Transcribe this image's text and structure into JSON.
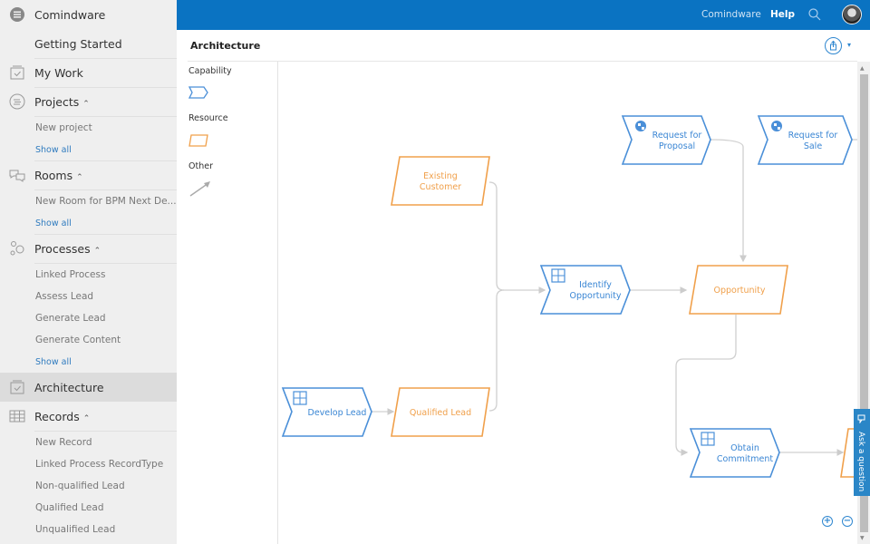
{
  "sidebar": {
    "brand": "Comindware",
    "getting_started": "Getting Started",
    "my_work": "My Work",
    "projects": {
      "label": "Projects",
      "items": [
        "New project"
      ],
      "show_all": "Show all"
    },
    "rooms": {
      "label": "Rooms",
      "items": [
        "New Room for BPM Next De..."
      ],
      "show_all": "Show all"
    },
    "processes": {
      "label": "Processes",
      "items": [
        "Linked Process",
        "Assess Lead",
        "Generate Lead",
        "Generate Content"
      ],
      "show_all": "Show all"
    },
    "architecture": "Architecture",
    "records": {
      "label": "Records",
      "items": [
        "New Record",
        "Linked Process RecordType",
        "Non-qualified Lead",
        "Qualified Lead",
        "Unqualified Lead"
      ]
    },
    "caret": "^"
  },
  "topbar": {
    "brand": "Comindware",
    "help": "Help",
    "search_icon": "search-icon",
    "avatar": "user-avatar"
  },
  "header": {
    "title": "Architecture",
    "share_caret": "▾"
  },
  "palette": {
    "capability": "Capability",
    "resource": "Resource",
    "other": "Other"
  },
  "diagram": {
    "colors": {
      "capability": "#4a8fd8",
      "resource": "#f0a04b",
      "connector": "#cccccc"
    },
    "nodes": {
      "request_for_proposal": {
        "line1": "Request for",
        "line2": "Proposal"
      },
      "request_for_sale": {
        "line1": "Request for",
        "line2": "Sale"
      },
      "existing_customer": {
        "line1": "Existing",
        "line2": "Customer"
      },
      "identify_opportunity": {
        "line1": "Identify",
        "line2": "Opportunity"
      },
      "opportunity": {
        "line1": "Opportunity"
      },
      "develop_lead": {
        "line1": "Develop Lead"
      },
      "qualified_lead": {
        "line1": "Qualified Lead"
      },
      "obtain_commitment": {
        "line1": "Obtain",
        "line2": "Commitment"
      }
    }
  },
  "ask_question": "Ask a question",
  "zoom": {
    "in": "+",
    "out": "−"
  }
}
